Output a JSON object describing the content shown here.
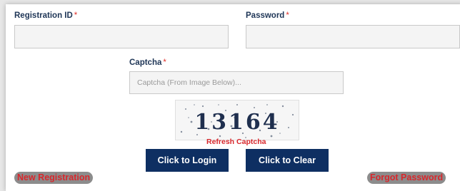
{
  "form": {
    "registration_id": {
      "label": "Registration ID",
      "required_mark": "*",
      "value": ""
    },
    "password": {
      "label": "Password",
      "required_mark": "*",
      "value": ""
    },
    "captcha": {
      "label": "Captcha",
      "required_mark": "*",
      "placeholder": "Captcha (From Image Below)...",
      "value": ""
    }
  },
  "captcha_image": {
    "text": "13164"
  },
  "refresh_captcha": "Refresh Captcha",
  "buttons": {
    "login": "Click to Login",
    "clear": "Click to Clear"
  },
  "links": {
    "new_registration": "New Registration",
    "forgot_password": "Forgot Password"
  },
  "colors": {
    "primary": "#0e2f62",
    "accent_red": "#d8272c",
    "label": "#1e3556"
  }
}
